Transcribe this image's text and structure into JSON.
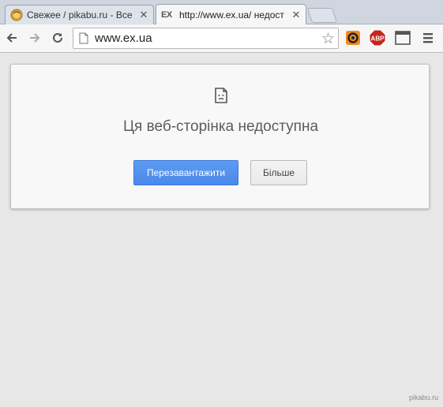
{
  "tabs": [
    {
      "title": "Свежее / pikabu.ru - Все",
      "favicon": "pikabu-favicon",
      "active": false
    },
    {
      "title": "http://www.ex.ua/ недост",
      "favicon_text": "EX",
      "active": true
    }
  ],
  "toolbar": {
    "back_icon": "back-arrow-icon",
    "forward_icon": "forward-arrow-icon",
    "reload_icon": "reload-icon",
    "url": "www.ex.ua",
    "extensions": [
      "mail-ext-icon",
      "adblock-plus-icon"
    ],
    "adblock_label": "ABP"
  },
  "error": {
    "title": "Ця веб-сторінка недоступна",
    "reload_label": "Перезавантажити",
    "more_label": "Більше"
  },
  "watermark": "pikabu.ru",
  "colors": {
    "accent_button": "#4a8af4",
    "page_bg": "#e7e7e7"
  }
}
